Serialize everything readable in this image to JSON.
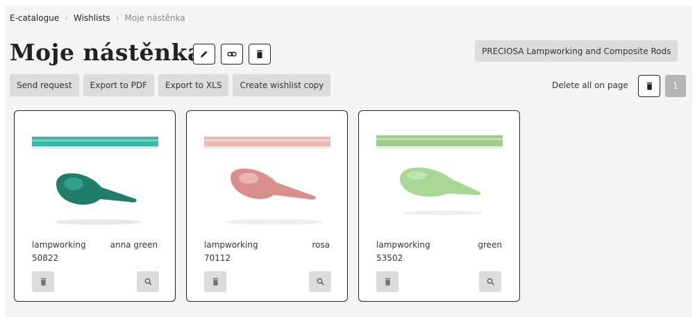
{
  "breadcrumb": [
    "E-catalogue",
    "Wishlists",
    "Moje nástěnka"
  ],
  "title": "Moje nástěnka",
  "category_button": "PRECIOSA Lampworking and Composite Rods",
  "actions": [
    "Send request",
    "Export to PDF",
    "Export to XLS",
    "Create wishlist copy"
  ],
  "delete_all_label": "Delete all on page",
  "page_number": "1",
  "products": [
    {
      "type": "lampworking",
      "color_name": "anna green",
      "code": "50822",
      "rod_color": "#3fb5a8",
      "drop_color": "#1f7d6a"
    },
    {
      "type": "lampworking",
      "color_name": "rosa",
      "code": "70112",
      "rod_color": "#e9b9b4",
      "drop_color": "#d9908d"
    },
    {
      "type": "lampworking",
      "color_name": "green",
      "code": "53502",
      "rod_color": "#9ccd8a",
      "drop_color": "#a9d896"
    }
  ],
  "colors": {
    "button_bg": "#dcdcdc",
    "panel_bg": "#f4f4f4",
    "page_badge": "#b5b5b5"
  }
}
